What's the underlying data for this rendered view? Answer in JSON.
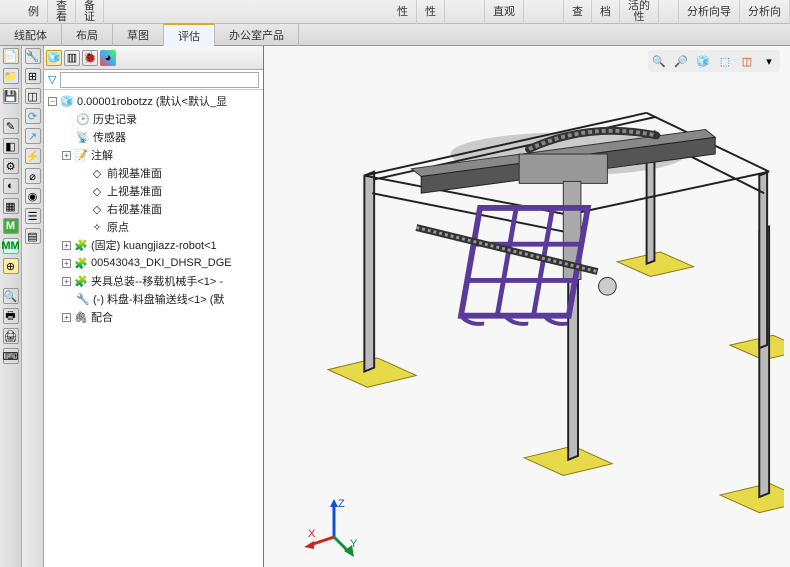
{
  "ribbon": [
    "例",
    "查\n看",
    "备\n证",
    "",
    "",
    "",
    "",
    "性",
    "性",
    "",
    "直观",
    "",
    "",
    "查",
    "档",
    "活的\n性",
    "",
    "分析向导",
    "分析向"
  ],
  "tabs": [
    "线配体",
    "布局",
    "草图",
    "评估",
    "办公室产品"
  ],
  "activeTab": 3,
  "filterPlaceholder": "",
  "tree": [
    {
      "type": "root",
      "label": "0.00001robotzz  (默认<默认_显",
      "icon": "assembly"
    },
    {
      "type": "child",
      "label": "历史记录",
      "icon": "history",
      "ind": 1
    },
    {
      "type": "child",
      "label": "传感器",
      "icon": "sensor",
      "ind": 1
    },
    {
      "type": "expandable",
      "label": "注解",
      "icon": "annotation",
      "ind": 1,
      "sign": "+"
    },
    {
      "type": "child",
      "label": "前视基准面",
      "icon": "plane",
      "ind": 2
    },
    {
      "type": "child",
      "label": "上视基准面",
      "icon": "plane",
      "ind": 2
    },
    {
      "type": "child",
      "label": "右视基准面",
      "icon": "plane",
      "ind": 2
    },
    {
      "type": "child",
      "label": "原点",
      "icon": "origin",
      "ind": 2
    },
    {
      "type": "expandable",
      "label": "(固定) kuangjiazz-robot<1",
      "icon": "part",
      "ind": 1,
      "sign": "+"
    },
    {
      "type": "expandable",
      "label": "00543043_DKI_DHSR_DGE",
      "icon": "part",
      "ind": 1,
      "sign": "+"
    },
    {
      "type": "expandable",
      "label": "夹具总装--移载机械手<1> -",
      "icon": "part",
      "ind": 1,
      "sign": "+"
    },
    {
      "type": "child",
      "label": "(-) 料盘-料盘输送线<1> (默",
      "icon": "part2",
      "ind": 1
    },
    {
      "type": "expandable",
      "label": "配合",
      "icon": "mate",
      "ind": 1,
      "sign": "+"
    }
  ],
  "triad": {
    "x": "X",
    "y": "Y",
    "z": "Z"
  }
}
